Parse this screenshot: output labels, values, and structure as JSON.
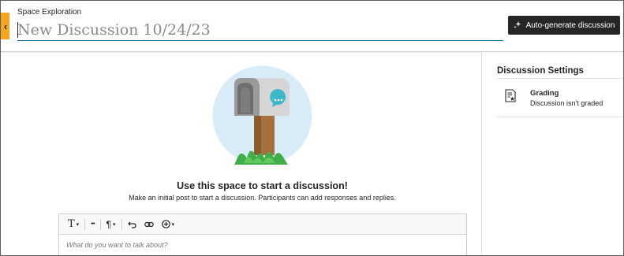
{
  "header": {
    "breadcrumb": "Space Exploration",
    "title_placeholder": "New Discussion 10/24/23",
    "auto_generate_label": "Auto-generate discussion",
    "back_glyph": "‹"
  },
  "main": {
    "headline": "Use this space to start a discussion!",
    "subline": "Make an initial post to start a discussion. Participants can add responses and replies.",
    "editor": {
      "placeholder": "What do you want to talk about?",
      "toolbar": {
        "text_format": "T",
        "more": "•••",
        "paragraph": "¶",
        "caret": "▾"
      }
    }
  },
  "sidebar": {
    "title": "Discussion Settings",
    "grading": {
      "label": "Grading",
      "status": "Discussion isn't graded"
    }
  },
  "colors": {
    "accent": "#f5a623",
    "button_bg": "#262626",
    "underline": "#0e6da5",
    "bubble": "#3eb8c8"
  }
}
